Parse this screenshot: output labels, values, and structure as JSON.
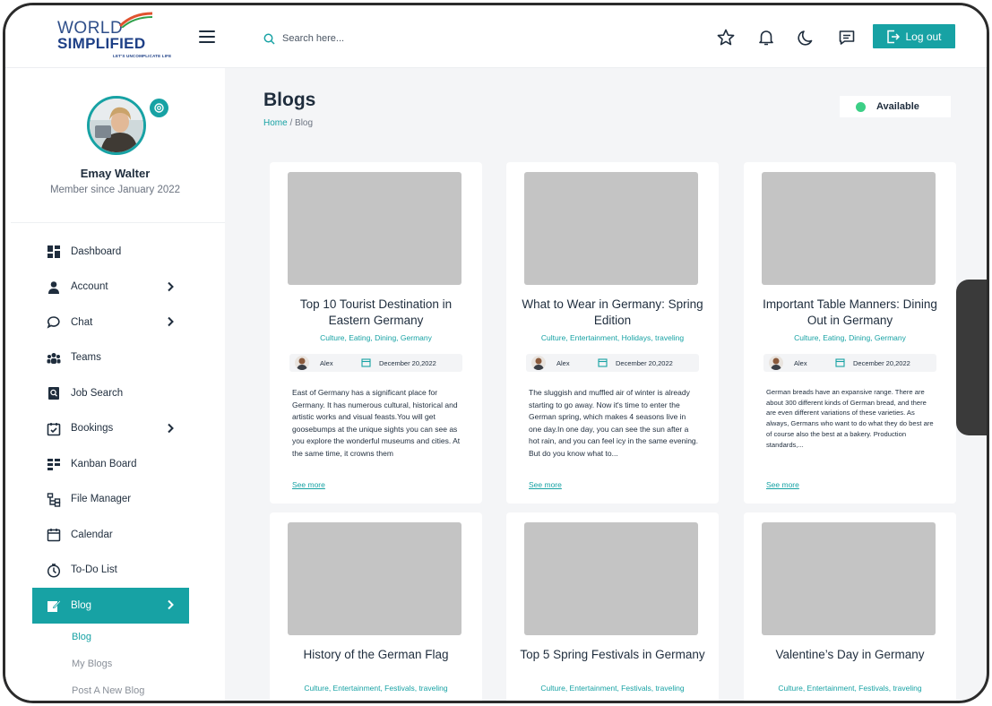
{
  "brand": {
    "line1": "WORLD",
    "line2": "SIMPLIFIED",
    "tagline": "LET'S UNCOMPLICATE LIFE"
  },
  "search": {
    "placeholder": "Search here..."
  },
  "header": {
    "icons": [
      "star-icon",
      "bell-icon",
      "moon-icon",
      "message-icon"
    ],
    "logout_label": "Log out"
  },
  "profile": {
    "name": "Emay Walter",
    "member_since": "Member since January 2022"
  },
  "sidebar": {
    "items": [
      {
        "label": "Dashboard",
        "icon": "dashboard-icon",
        "has_children": false
      },
      {
        "label": "Account",
        "icon": "user-icon",
        "has_children": true
      },
      {
        "label": "Chat",
        "icon": "chat-icon",
        "has_children": true
      },
      {
        "label": "Teams",
        "icon": "teams-icon",
        "has_children": false
      },
      {
        "label": "Job Search",
        "icon": "job-search-icon",
        "has_children": false
      },
      {
        "label": "Bookings",
        "icon": "bookings-icon",
        "has_children": true
      },
      {
        "label": "Kanban Board",
        "icon": "kanban-icon",
        "has_children": false
      },
      {
        "label": "File Manager",
        "icon": "file-manager-icon",
        "has_children": false
      },
      {
        "label": "Calendar",
        "icon": "calendar-icon",
        "has_children": false
      },
      {
        "label": "To-Do List",
        "icon": "timer-icon",
        "has_children": false
      },
      {
        "label": "Blog",
        "icon": "blog-icon",
        "has_children": true,
        "active": true
      }
    ],
    "sub_items": [
      {
        "label": "Blog",
        "current": true
      },
      {
        "label": "My Blogs",
        "current": false
      },
      {
        "label": "Post A New Blog",
        "current": false
      }
    ]
  },
  "page": {
    "title": "Blogs",
    "breadcrumb_home": "Home",
    "breadcrumb_sep": "/",
    "breadcrumb_current": "Blog",
    "status": "Available",
    "status_color": "#3ccf86"
  },
  "accent_color": "#17a2a4",
  "posts": [
    {
      "title": "Top 10 Tourist Destination in Eastern Germany",
      "tags": "Culture, Eating, Dining, Germany",
      "author": "Alex",
      "date": "December 20,2022",
      "excerpt": "East of Germany has a significant place for Germany. It has numerous cultural, historical and artistic works and visual feasts.You will get goosebumps at the unique sights you can see as you explore the wonderful museums and cities. At the same time, it crowns them",
      "see_more": "See more"
    },
    {
      "title": "What to Wear in Germany: Spring Edition",
      "tags": "Culture, Entertainment, Holidays, traveling",
      "author": "Alex",
      "date": "December 20,2022",
      "excerpt": "The sluggish and muffled air of winter is already starting to go away. Now it's time to enter the German spring, which makes 4 seasons live in one day.In one day, you can see the sun after a hot rain, and you can feel icy in the same evening. But do you know what to...",
      "see_more": "See more"
    },
    {
      "title": "Important Table Manners: Dining Out in Germany",
      "tags": "Culture, Eating, Dining, Germany",
      "author": "Alex",
      "date": "December 20,2022",
      "excerpt": "German breads have an expansive range. There are about 300 different kinds of German bread, and there are even different variations of these varieties. As always, Germans who want to do what they do best are of course also the best at a bakery. Production standards,...",
      "see_more": "See more"
    },
    {
      "title": "History of the German Flag",
      "tags": "Culture, Entertainment, Festivals, traveling"
    },
    {
      "title": "Top 5 Spring Festivals in Germany",
      "tags": "Culture, Entertainment, Festivals, traveling"
    },
    {
      "title": "Valentine’s Day in Germany",
      "tags": "Culture, Entertainment, Festivals, traveling"
    }
  ]
}
